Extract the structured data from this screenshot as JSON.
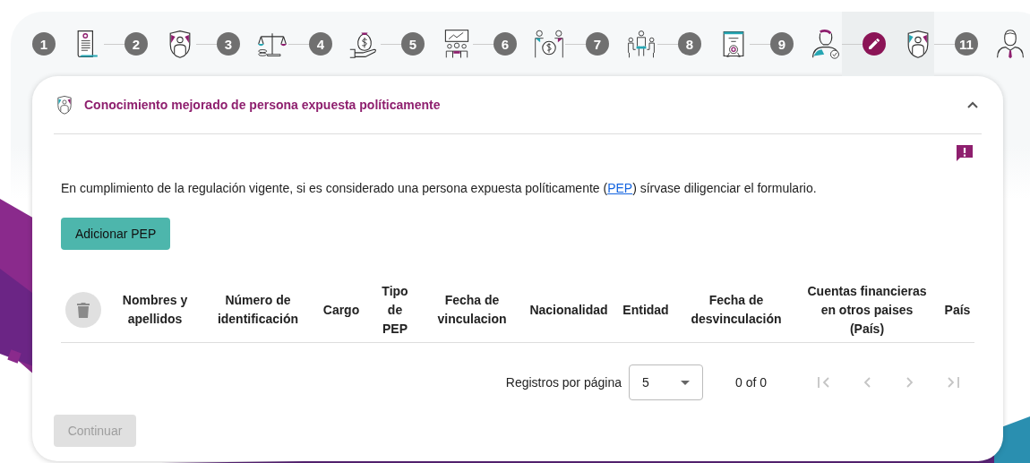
{
  "steps": [
    {
      "label": "1",
      "current": false
    },
    {
      "label": "2",
      "current": false
    },
    {
      "label": "3",
      "current": false
    },
    {
      "label": "4",
      "current": false
    },
    {
      "label": "5",
      "current": false
    },
    {
      "label": "6",
      "current": false
    },
    {
      "label": "7",
      "current": false
    },
    {
      "label": "8",
      "current": false
    },
    {
      "label": "9",
      "current": false
    },
    {
      "current": true
    },
    {
      "label": "11",
      "current": false
    }
  ],
  "section": {
    "title": "Conocimiento mejorado de persona expuesta políticamente",
    "expanded": true
  },
  "intro": {
    "before": "En cumplimiento de la regulación vigente, si es considerado una persona expuesta políticamente (",
    "link": "PEP",
    "after": ") sírvase diligenciar el formulario."
  },
  "add_button": "Adicionar PEP",
  "table": {
    "columns": [
      "Nombres y apellidos",
      "Número de identificación",
      "Cargo",
      "Tipo de PEP",
      "Fecha de vinculacion",
      "Nacionalidad",
      "Entidad",
      "Fecha de desvinculación",
      "Cuentas financieras en otros paises (País)",
      "País"
    ]
  },
  "pagination": {
    "rows_per_page_label": "Registros por página",
    "rows_per_page": "5",
    "range": "0 of 0"
  },
  "continue_button": {
    "label": "Continuar",
    "disabled": true
  }
}
